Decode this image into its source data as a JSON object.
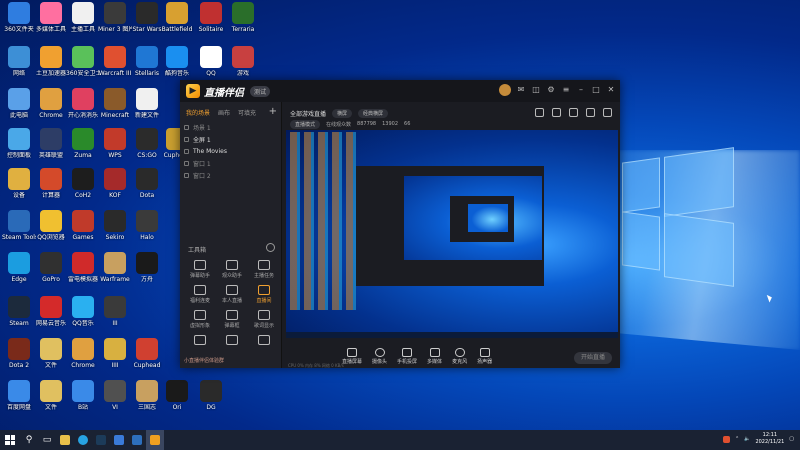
{
  "desktop": {
    "icons": [
      {
        "label": "360文件夹",
        "color": "#2f7de0"
      },
      {
        "label": "多媒体工具",
        "color": "#ff6fa0"
      },
      {
        "label": "主播工具",
        "color": "#f0f0f0"
      },
      {
        "label": "Miner 3 图片",
        "color": "#3a3a3a"
      },
      {
        "label": "Star Wars",
        "color": "#2a2a2a"
      },
      {
        "label": "Battlefield",
        "color": "#d8a030"
      },
      {
        "label": "Solitaire",
        "color": "#c03030"
      },
      {
        "label": "Terraria",
        "color": "#2a6e2a"
      },
      {
        "label": "网络",
        "color": "#3d8fd6"
      },
      {
        "label": "土豆加速器",
        "color": "#f0a030"
      },
      {
        "label": "360安全卫士",
        "color": "#5ac15a"
      },
      {
        "label": "Warcraft III",
        "color": "#e05030"
      },
      {
        "label": "Stellaris",
        "color": "#1f77d4"
      },
      {
        "label": "酷狗音乐",
        "color": "#1a8ff0"
      },
      {
        "label": "QQ",
        "color": "#ffffff"
      },
      {
        "label": "游戏",
        "color": "#c84040"
      },
      {
        "label": "此电脑",
        "color": "#5aa0e8"
      },
      {
        "label": "Chrome",
        "color": "#e0a040"
      },
      {
        "label": "开心消消乐",
        "color": "#e04060"
      },
      {
        "label": "Minecraft",
        "color": "#8a5a2a"
      },
      {
        "label": "新建文件",
        "color": "#f0f0f0"
      },
      {
        "label": "控制面板",
        "color": "#4aa8e8"
      },
      {
        "label": "英雄联盟",
        "color": "#2d3d66"
      },
      {
        "label": "Zuma",
        "color": "#2a8a2a"
      },
      {
        "label": "WPS",
        "color": "#c23a2a"
      },
      {
        "label": "CS:GO",
        "color": "#2b2b2b"
      },
      {
        "label": "Cuphead",
        "color": "#caa030"
      },
      {
        "label": "设备",
        "color": "#e0b040"
      },
      {
        "label": "计算器",
        "color": "#d44a2a"
      },
      {
        "label": "CoH2",
        "color": "#1d1d1d"
      },
      {
        "label": "KOF",
        "color": "#a52a2a"
      },
      {
        "label": "Dota",
        "color": "#2a2a2a"
      },
      {
        "label": "Steam Tools",
        "color": "#2a6ab8"
      },
      {
        "label": "QQ浏览器",
        "color": "#f0c030"
      },
      {
        "label": "Games",
        "color": "#c03a2a"
      },
      {
        "label": "Sekiro",
        "color": "#2a2a2a"
      },
      {
        "label": "Halo",
        "color": "#3a3a3a"
      },
      {
        "label": "Edge",
        "color": "#1b9de0"
      },
      {
        "label": "GoPro",
        "color": "#303030"
      },
      {
        "label": "雷电模拟器",
        "color": "#d02a2a"
      },
      {
        "label": "Warframe",
        "color": "#c8a060"
      },
      {
        "label": "方舟",
        "color": "#1a1a1a"
      },
      {
        "label": "Steam",
        "color": "#1c2a3c"
      },
      {
        "label": "网易云音乐",
        "color": "#d42a2a"
      },
      {
        "label": "QQ音乐",
        "color": "#2ab0f0"
      },
      {
        "label": "III",
        "color": "#3a3a3a"
      },
      {
        "label": "Dota 2",
        "color": "#7a2a1a"
      },
      {
        "label": "文件",
        "color": "#e0c060"
      },
      {
        "label": "Chrome",
        "color": "#e0a040"
      },
      {
        "label": "IIII",
        "color": "#d8b040"
      },
      {
        "label": "Cuphead",
        "color": "#d04030"
      },
      {
        "label": "百度网盘",
        "color": "#3a8ae8"
      },
      {
        "label": "文件",
        "color": "#e0c060"
      },
      {
        "label": "B站",
        "color": "#3a8ae8"
      },
      {
        "label": "VI",
        "color": "#505050"
      },
      {
        "label": "三国志",
        "color": "#c8a060"
      },
      {
        "label": "Ori",
        "color": "#1a1a1a"
      },
      {
        "label": "DG",
        "color": "#2a2a2a"
      }
    ]
  },
  "app": {
    "title": "直播伴侣",
    "badge": "测试",
    "left_tabs": [
      "我的场景",
      "画布",
      "可填充"
    ],
    "scenes": [
      "场景 1",
      "全屏 1",
      "The Movies",
      "窗口 1",
      "窗口 2"
    ],
    "tools_title": "工具箱",
    "tools": [
      {
        "label": "弹幕助手",
        "hot": false
      },
      {
        "label": "观众助手",
        "hot": false
      },
      {
        "label": "主播任务",
        "hot": false
      },
      {
        "label": "福利连麦",
        "hot": false
      },
      {
        "label": "本人直播",
        "hot": false
      },
      {
        "label": "直播间",
        "hot": true
      },
      {
        "label": "虚拟形象",
        "hot": false
      },
      {
        "label": "弹幕框",
        "hot": false
      },
      {
        "label": "歌词显示",
        "hot": false
      },
      {
        "label": "",
        "hot": false
      },
      {
        "label": "",
        "hot": false
      },
      {
        "label": "",
        "hot": false
      }
    ],
    "bottom_tip": "小直播伴侣体验群",
    "main_title": "全部游戏直播",
    "main_pill1": "横屏",
    "main_pill2": "经典横屏",
    "main_sub": [
      "直播模式",
      "在线观众数",
      "887798",
      "13902",
      "66"
    ],
    "controls": [
      "直播屏幕",
      "摄像头",
      "手机投屏",
      "多媒体",
      "麦克风",
      "扬声器"
    ],
    "start_live": "开始直播",
    "status": "CPU 0%  内存 8%  网络 0 KB/s"
  },
  "taskbar": {
    "clock_time": "12:11",
    "clock_date": "2022/11/21"
  }
}
